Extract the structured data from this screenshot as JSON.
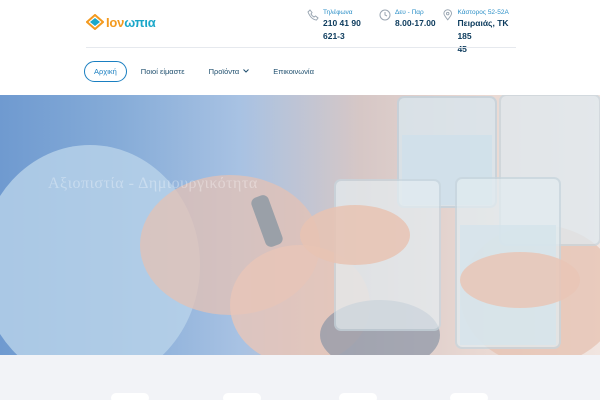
{
  "brand": {
    "name_prefix": "Ιον",
    "name_suffix": "ωπια",
    "logo_icon": "diamond-logo-icon"
  },
  "header": {
    "phone": {
      "icon": "phone-icon",
      "label": "Τηλέφωνα",
      "value_line1": "210 41 90",
      "value_line2": "621-3"
    },
    "hours": {
      "icon": "clock-icon",
      "label": "Δευ - Παρ",
      "value": "8.00-17.00"
    },
    "address": {
      "icon": "location-pin-icon",
      "label": "Κάστορος 52-52Α",
      "value_line1": "Πειραιάς, ΤΚ 185",
      "value_line2": "45"
    }
  },
  "nav": {
    "items": [
      {
        "label": "Αρχική",
        "active": true
      },
      {
        "label": "Ποιοί είμαστε"
      },
      {
        "label": "Προϊόντα",
        "has_dropdown": true
      },
      {
        "label": "Επικοινωνία"
      }
    ]
  },
  "hero": {
    "caption": "Αξιοπιστία - Δημιουργικότητα"
  },
  "colors": {
    "accent": "#1a7fc1",
    "brand_orange": "#f39a1f",
    "brand_blue": "#1aa7c9",
    "dark_text": "#0b3a5c"
  }
}
